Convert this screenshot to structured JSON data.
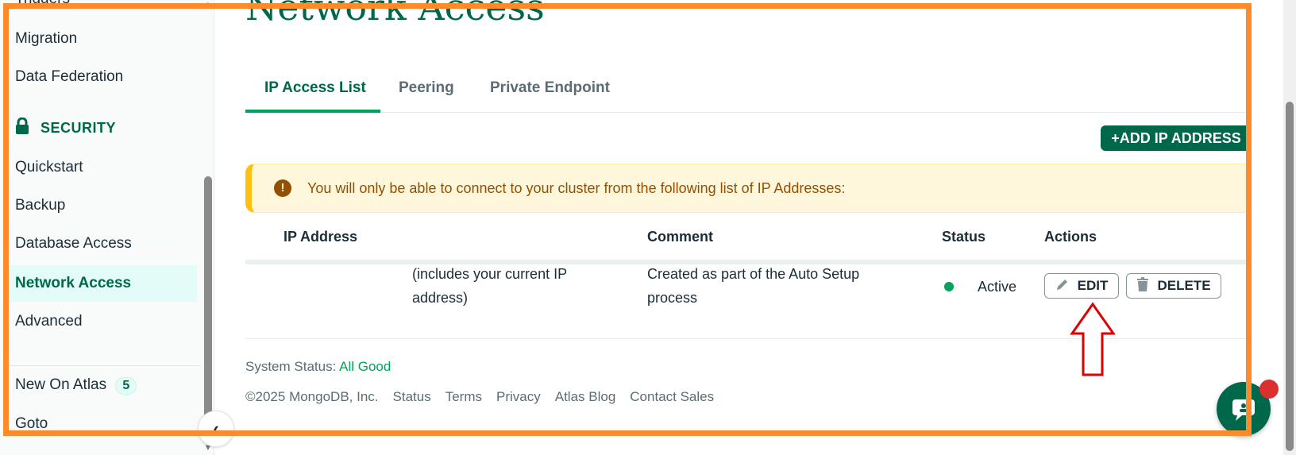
{
  "sidebar": {
    "cut_item": "Triggers",
    "items_top": [
      "Migration",
      "Data Federation"
    ],
    "security_header": "SECURITY",
    "security_items": [
      "Quickstart",
      "Backup",
      "Database Access",
      "Network Access",
      "Advanced"
    ],
    "active_item": "Network Access",
    "new_on_atlas": "New On Atlas",
    "new_count": "5",
    "goto": "Goto",
    "collapse_icon": "chevron-left-icon",
    "lock_icon": "lock-icon"
  },
  "main": {
    "title": "Network Access",
    "tabs": [
      {
        "label": "IP Access List",
        "active": true
      },
      {
        "label": "Peering",
        "active": false
      },
      {
        "label": "Private Endpoint",
        "active": false
      }
    ],
    "add_button": "+ADD IP ADDRESS",
    "banner_text": "You will only be able to connect to your cluster from the following list of IP Addresses:",
    "banner_icon": "!",
    "table": {
      "headers": [
        "IP Address",
        "Comment",
        "Status",
        "Actions"
      ],
      "rows": [
        {
          "ip_note_line1": "(includes your current IP",
          "ip_note_line2": "address)",
          "comment_line1": "Created as part of the Auto Setup",
          "comment_line2": "process",
          "status": "Active",
          "edit_label": "EDIT",
          "delete_label": "DELETE"
        }
      ]
    },
    "system_status_label": "System Status:",
    "system_status_value": "All Good",
    "footer_links": [
      "©2025 MongoDB, Inc.",
      "Status",
      "Terms",
      "Privacy",
      "Atlas Blog",
      "Contact Sales"
    ]
  },
  "colors": {
    "brand_green": "#00684a",
    "status_green": "#00a35c",
    "banner_bg": "#fef7db",
    "annotation_orange": "#ff8a2b",
    "annotation_red": "#e00000"
  }
}
